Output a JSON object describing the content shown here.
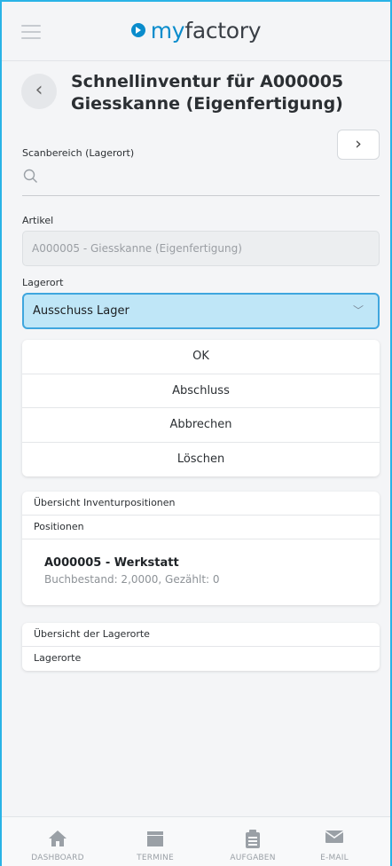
{
  "header": {
    "logo_my": "my",
    "logo_factory": "factory"
  },
  "title": {
    "line1": "Schnellinventur für A000005",
    "line2": "Giesskanne (Eigenfertigung)"
  },
  "scan": {
    "label": "Scanbereich (Lagerort)",
    "value": ""
  },
  "article": {
    "label": "Artikel",
    "value": "A000005 - Giesskanne (Eigenfertigung)"
  },
  "location": {
    "label": "Lagerort",
    "selected": "Ausschuss Lager"
  },
  "actions": [
    "OK",
    "Abschluss",
    "Abbrechen",
    "Löschen"
  ],
  "overview_positions": {
    "title": "Übersicht Inventurpositionen",
    "subtitle": "Positionen",
    "items": [
      {
        "title": "A000005 - Werkstatt",
        "detail": "Buchbestand: 2,0000, Gezählt: 0"
      }
    ]
  },
  "overview_locations": {
    "title": "Übersicht der Lagerorte",
    "subtitle": "Lagerorte"
  },
  "bottom_nav": [
    {
      "label": "DASHBOARD",
      "icon": "home-icon"
    },
    {
      "label": "TERMINE",
      "icon": "calendar-icon"
    },
    {
      "label": "AUFGABEN",
      "icon": "clipboard-icon"
    },
    {
      "label": "E-MAIL",
      "icon": "mail-icon"
    }
  ],
  "colors": {
    "accent": "#0a8ccc",
    "select_bg": "#bfe6f7",
    "select_border": "#3fa6de",
    "frame": "#29b3e6"
  }
}
